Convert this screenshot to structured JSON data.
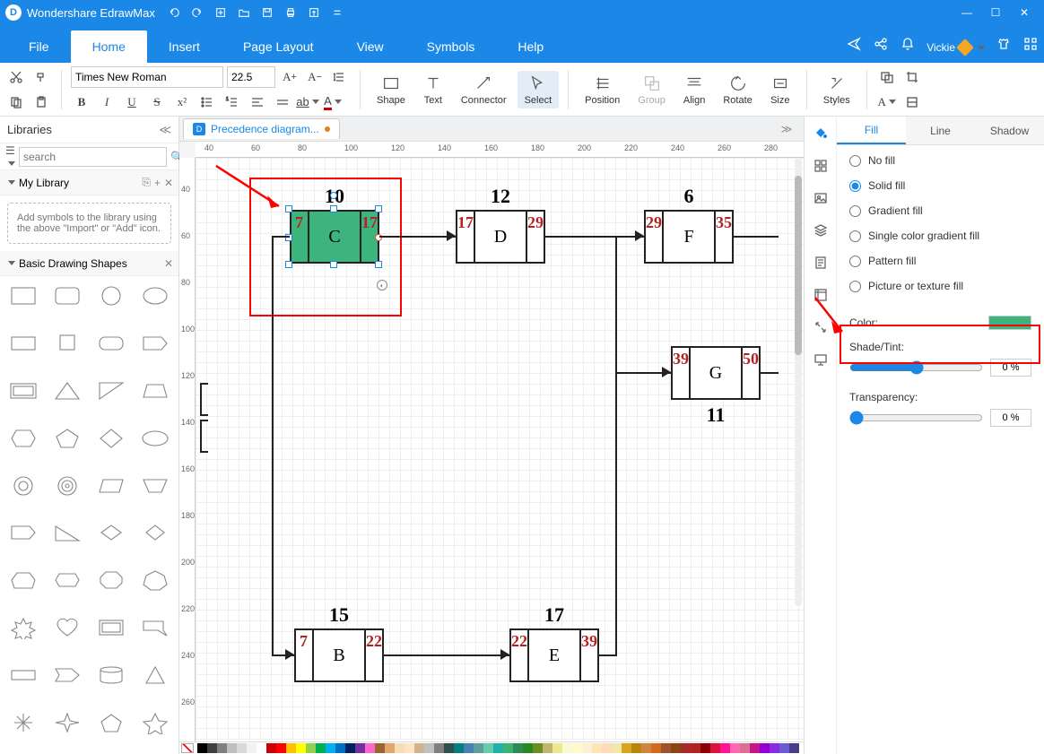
{
  "app": {
    "title": "Wondershare EdrawMax",
    "user": "Vickie"
  },
  "menu": {
    "file": "File",
    "home": "Home",
    "insert": "Insert",
    "page_layout": "Page Layout",
    "view": "View",
    "symbols": "Symbols",
    "help": "Help"
  },
  "ribbon": {
    "font": "Times New Roman",
    "size": "22.5",
    "shape": "Shape",
    "text": "Text",
    "connector": "Connector",
    "select": "Select",
    "position": "Position",
    "group": "Group",
    "align": "Align",
    "rotate": "Rotate",
    "sizeTool": "Size",
    "styles": "Styles"
  },
  "left": {
    "title": "Libraries",
    "search_ph": "search",
    "mylib": "My Library",
    "libmsg": "Add symbols to the library using the above \"Import\" or \"Add\" icon.",
    "basicshapes": "Basic Drawing Shapes"
  },
  "tab": {
    "name": "Precedence diagram..."
  },
  "ruler_h": [
    40,
    60,
    80,
    100,
    120,
    140,
    160,
    180,
    200,
    220,
    240,
    260,
    280
  ],
  "ruler_v": [
    40,
    60,
    80,
    100,
    120,
    140,
    160,
    180,
    200,
    220,
    240,
    260
  ],
  "nodes": {
    "C": {
      "label": "C",
      "top": "10",
      "l": "7",
      "r": "17"
    },
    "D": {
      "label": "D",
      "top": "12",
      "l": "17",
      "r": "29"
    },
    "F": {
      "label": "F",
      "top": "6",
      "l": "29",
      "r": "35"
    },
    "G": {
      "label": "G",
      "bot": "11",
      "l": "39",
      "r": "50"
    },
    "B": {
      "label": "B",
      "top": "15",
      "l": "7",
      "r": "22"
    },
    "E": {
      "label": "E",
      "top": "17",
      "l": "22",
      "r": "39"
    }
  },
  "right": {
    "fill": "Fill",
    "line": "Line",
    "shadow": "Shadow",
    "nofill": "No fill",
    "solid": "Solid fill",
    "gradient": "Gradient fill",
    "single": "Single color gradient fill",
    "pattern": "Pattern fill",
    "picture": "Picture or texture fill",
    "color": "Color:",
    "shade": "Shade/Tint:",
    "transparency": "Transparency:",
    "shade_val": "0 %",
    "trans_val": "0 %"
  },
  "palette": [
    "#000",
    "#3f3f3f",
    "#7f7f7f",
    "#bfbfbf",
    "#d9d9d9",
    "#f2f2f2",
    "#fff",
    "#c00",
    "#f00",
    "#ffc000",
    "#ff0",
    "#92d050",
    "#00b050",
    "#00b0f0",
    "#0070c0",
    "#002060",
    "#7030a0",
    "#ff66cc",
    "#996633",
    "#e2a76f",
    "#f5deb3",
    "#ffe4c4",
    "#d2b48c",
    "#c0c0c0",
    "#808080",
    "#2f4f4f",
    "#008080",
    "#4682b4",
    "#5f9ea0",
    "#66cdaa",
    "#20b2aa",
    "#3cb371",
    "#2e8b57",
    "#228b22",
    "#6b8e23",
    "#bdb76b",
    "#f0e68c",
    "#fafad2",
    "#fffacd",
    "#ffefd5",
    "#ffe4b5",
    "#ffdab9",
    "#eee8aa",
    "#daa520",
    "#b8860b",
    "#cd853f",
    "#d2691e",
    "#a0522d",
    "#8b4513",
    "#a52a2a",
    "#b22222",
    "#8b0000",
    "#dc143c",
    "#ff1493",
    "#ff69b4",
    "#db7093",
    "#c71585",
    "#9400d3",
    "#8a2be2",
    "#6a5acd",
    "#483d8b"
  ]
}
